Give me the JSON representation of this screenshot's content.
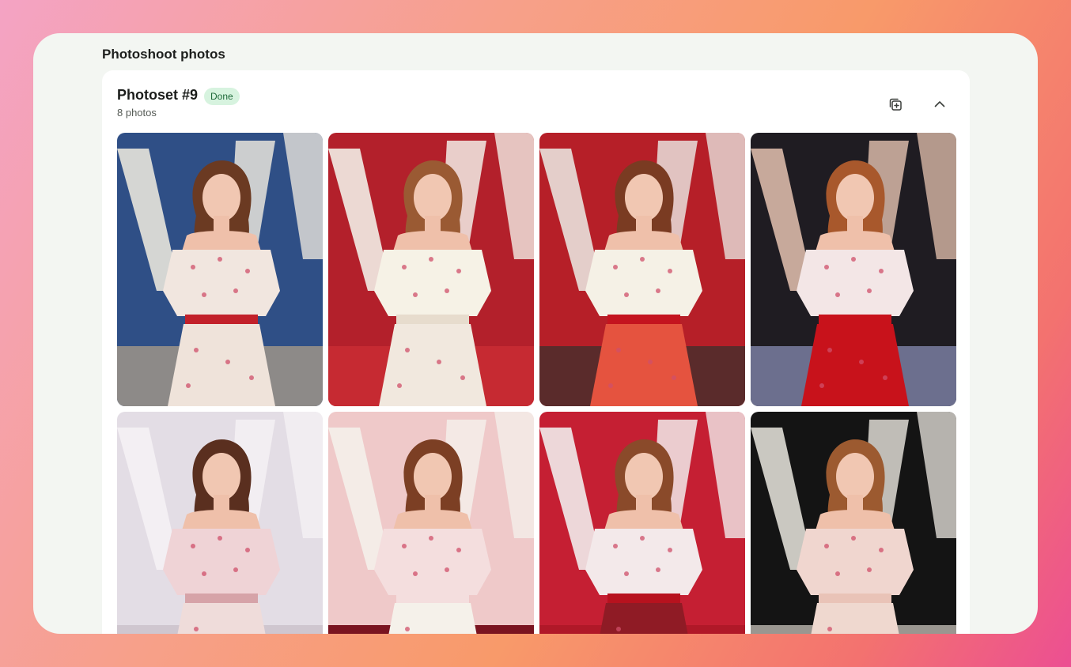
{
  "section": {
    "title": "Photoshoot photos"
  },
  "photoset": {
    "title": "Photoset #9",
    "status": "Done",
    "count_label": "8 photos"
  },
  "icons": {
    "duplicate": "duplicate-icon",
    "collapse": "chevron-up-icon"
  },
  "colors": {
    "badge_bg": "#d7f3df",
    "badge_text": "#1f6a3a",
    "card_bg": "#ffffff",
    "window_bg": "#f3f6f2"
  },
  "photos": [
    {
      "bg": "#2f4f86",
      "accent": "#e8e4dc",
      "floor": "#8d8a88",
      "top": "#f1e6df",
      "bottom": "#efe3da",
      "belt": "#c2202a"
    },
    {
      "bg": "#b3202b",
      "accent": "#f2ede6",
      "floor": "#c62a32",
      "top": "#f6f2e6",
      "bottom": "#f1e8de",
      "belt": "#e7dccd"
    },
    {
      "bg": "#b61f28",
      "accent": "#e9e1dc",
      "floor": "#5a2b2b",
      "top": "#f5f1e6",
      "bottom": "#e5533f",
      "belt": "#c4141f"
    },
    {
      "bg": "#1f1c22",
      "accent": "#d9b9a8",
      "floor": "#6c6f8e",
      "top": "#f3e6e6",
      "bottom": "#c8121b",
      "belt": "#c8121b"
    },
    {
      "bg": "#e3dde5",
      "accent": "#f4f1f4",
      "floor": "#cfc6cf",
      "top": "#efd3d6",
      "bottom": "#efdcda",
      "belt": "#d6a3a8"
    },
    {
      "bg": "#efc9c9",
      "accent": "#f4efea",
      "floor": "#7a1420",
      "top": "#f4dede",
      "bottom": "#f5f1ea",
      "belt": "#f4dede"
    },
    {
      "bg": "#c51f33",
      "accent": "#f1ebeb",
      "floor": "#b01828",
      "top": "#f3e9ea",
      "bottom": "#8f1b25",
      "belt": "#b7121e"
    },
    {
      "bg": "#141414",
      "accent": "#dedbd4",
      "floor": "#9a9690",
      "top": "#f0d6cf",
      "bottom": "#efd8cf",
      "belt": "#e9c3b7"
    }
  ]
}
